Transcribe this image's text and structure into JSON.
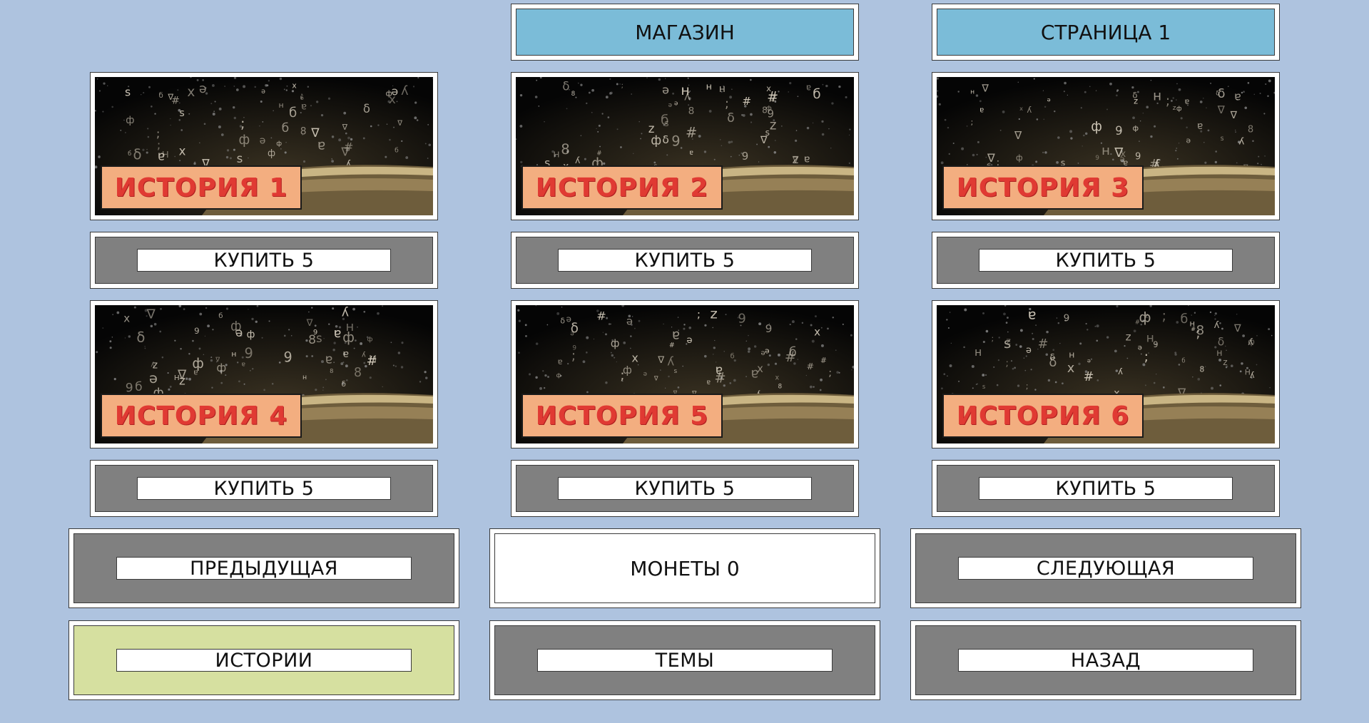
{
  "header": {
    "title": "МАГАЗИН",
    "page_label": "СТРАНИЦА 1"
  },
  "stories": [
    {
      "label": "ИСТОРИЯ 1",
      "buy_label": "КУПИТЬ  5"
    },
    {
      "label": "ИСТОРИЯ 2",
      "buy_label": "КУПИТЬ  5"
    },
    {
      "label": "ИСТОРИЯ 3",
      "buy_label": "КУПИТЬ  5"
    },
    {
      "label": "ИСТОРИЯ 4",
      "buy_label": "КУПИТЬ  5"
    },
    {
      "label": "ИСТОРИЯ 5",
      "buy_label": "КУПИТЬ  5"
    },
    {
      "label": "ИСТОРИЯ 6",
      "buy_label": "КУПИТЬ  5"
    }
  ],
  "nav": {
    "previous_label": "ПРЕДЫДУЩАЯ",
    "coins_label": "МОНЕТЫ 0",
    "next_label": "СЛЕДУЮЩАЯ"
  },
  "bottom": {
    "stories_label": "ИСТОРИИ",
    "themes_label": "ТЕМЫ",
    "back_label": "НАЗАД"
  },
  "colors": {
    "background": "#aec3df",
    "header": "#7bbcd8",
    "button_gray": "#808080",
    "stories_active": "#d6e0a0",
    "story_tag": "#f3ae80",
    "story_tag_text": "#e03a33"
  },
  "icons": {
    "story_image": "book-with-flying-letters-image"
  }
}
